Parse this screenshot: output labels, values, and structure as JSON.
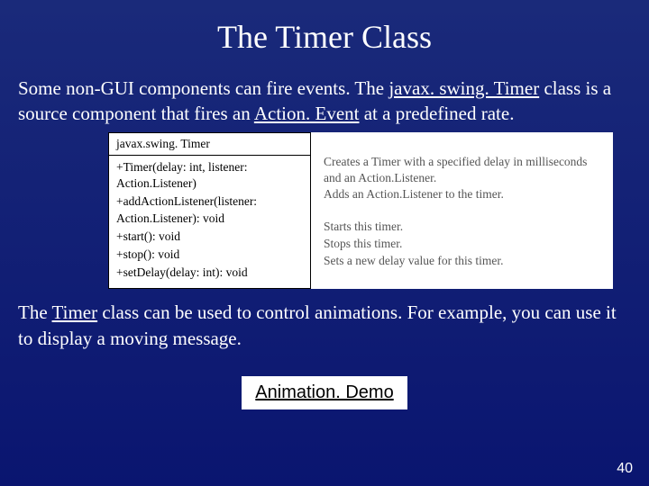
{
  "title": "The Timer Class",
  "para1_pre": "Some non-GUI components can fire events. The ",
  "para1_link1": "javax. swing. Timer",
  "para1_mid": " class is a source component that fires an ",
  "para1_link2": "Action. Event",
  "para1_post": " at a predefined rate.",
  "uml": {
    "header": "javax.swing. Timer",
    "rows": [
      "+Timer(delay: int, listener: Action.Listener)",
      "+addActionListener(listener: Action.Listener): void",
      "+start(): void",
      "+stop(): void",
      "+setDelay(delay: int): void"
    ],
    "descs": [
      "Creates a Timer with a specified delay in milliseconds and an Action.Listener.",
      "Adds an Action.Listener to the timer.",
      "Starts this timer.",
      "Stops this timer.",
      "Sets a new delay value for this timer."
    ]
  },
  "para2_pre": "The ",
  "para2_link": "Timer",
  "para2_post": " class can be used to control animations. For example, you can use it to display a moving message.",
  "button": "Animation. Demo",
  "pagenum": "40"
}
